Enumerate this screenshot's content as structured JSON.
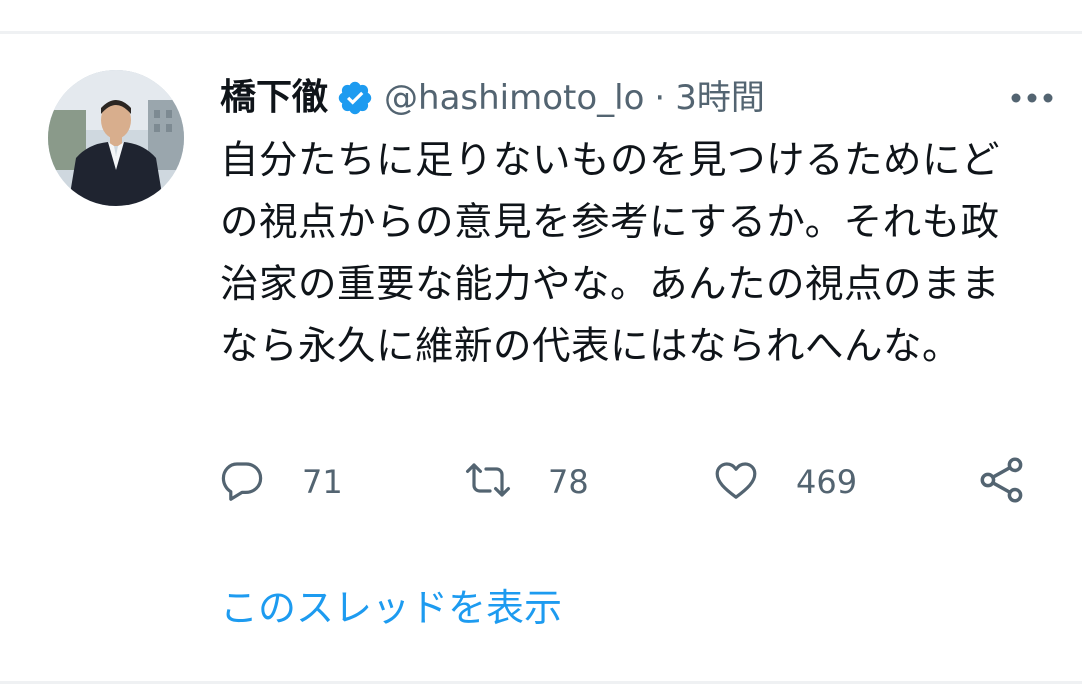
{
  "tweet": {
    "display_name": "橋下徹",
    "handle": "@hashimoto_lo",
    "separator": "·",
    "time": "3時間",
    "text": "自分たちに足りないものを見つけるためにどの視点からの意見を参考にするか。それも政治家の重要な能力やな。あんたの視点のままなら永久に維新の代表にはなられへんな。",
    "actions": {
      "reply_count": "71",
      "retweet_count": "78",
      "like_count": "469"
    },
    "show_thread_label": "このスレッドを表示"
  },
  "icons": {
    "verified": "verified-badge-icon",
    "more": "more-dots-icon",
    "reply": "reply-icon",
    "retweet": "retweet-icon",
    "like": "heart-icon",
    "share": "share-icon"
  },
  "colors": {
    "accent": "#1d9bf0",
    "text": "#0f1419",
    "secondary": "#536471",
    "divider": "#eff1f3"
  }
}
